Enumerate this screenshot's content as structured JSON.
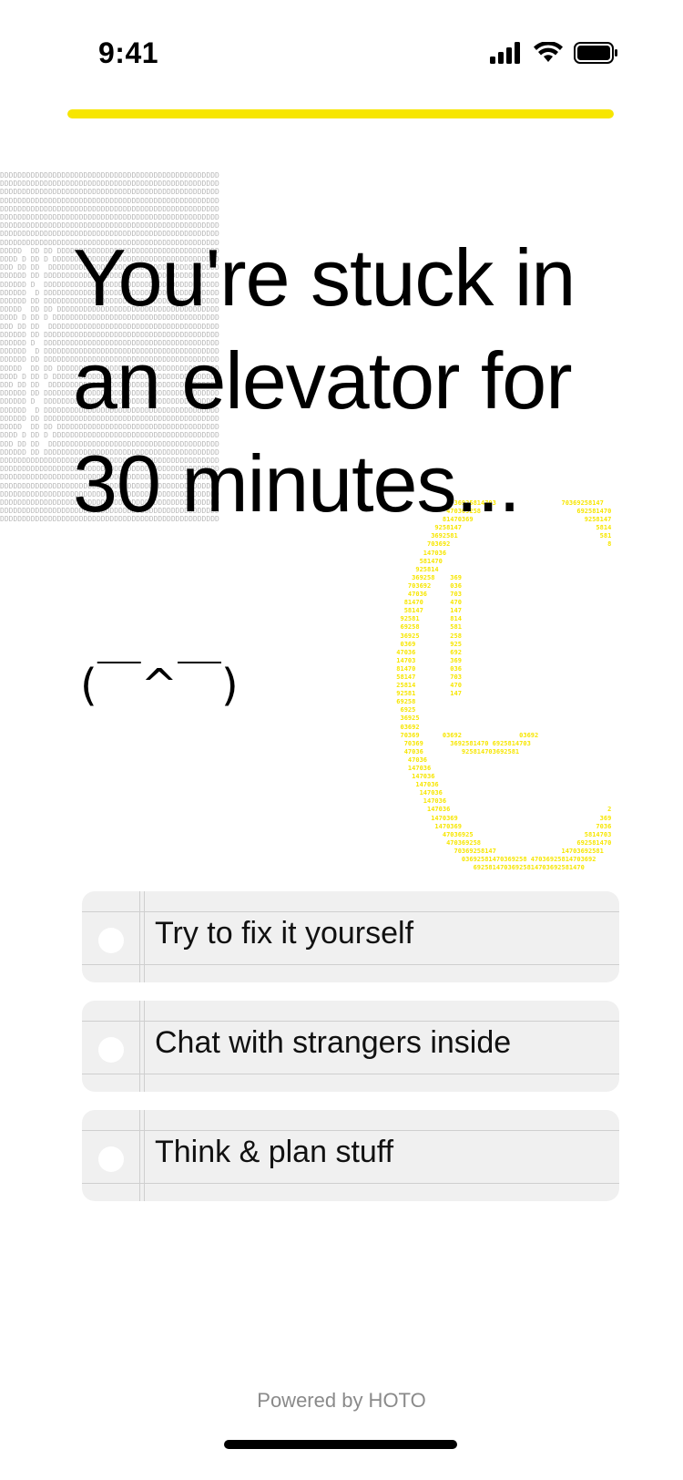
{
  "status_bar": {
    "time": "9:41",
    "icons": [
      "signal-icon",
      "wifi-icon",
      "battery-icon"
    ]
  },
  "progress": {
    "value": 1.0,
    "color": "#f7e600"
  },
  "question": {
    "text": "You're stuck in an elevator for 30 minutes...",
    "kaomoji": "(￣^￣)"
  },
  "options": [
    {
      "label": "Try to fix it yourself"
    },
    {
      "label": "Chat with strangers inside"
    },
    {
      "label": "Think & plan stuff"
    }
  ],
  "footer": {
    "powered_by": "Powered by HOTO"
  },
  "colors": {
    "accent": "#f7e600",
    "option_bg": "#f0f0f0",
    "ascii_gray": "#b9b9b9"
  }
}
